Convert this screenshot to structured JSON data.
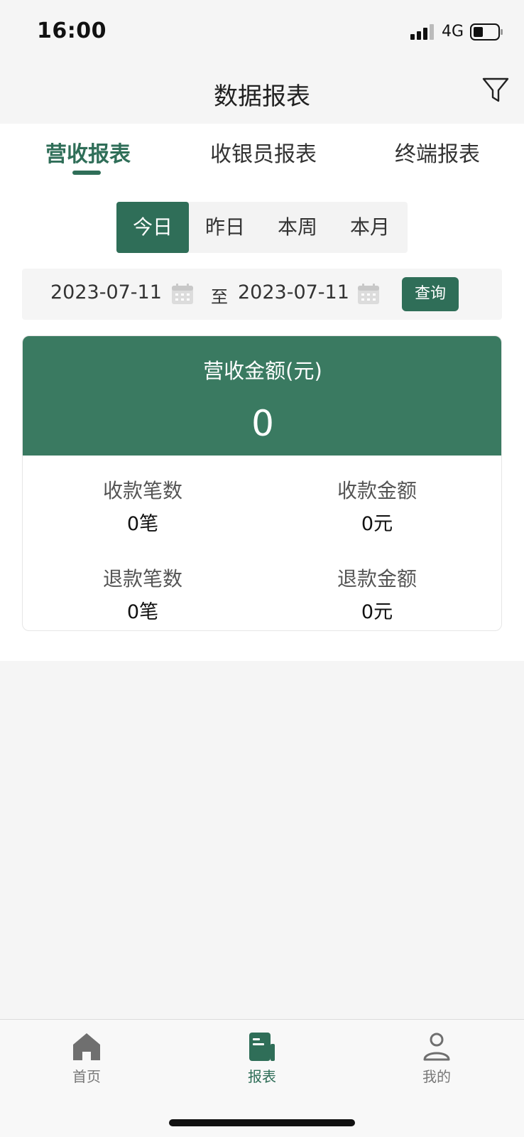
{
  "status_bar": {
    "time": "16:00",
    "network": "4G"
  },
  "header": {
    "title": "数据报表"
  },
  "tabs": [
    {
      "label": "营收报表",
      "active": true
    },
    {
      "label": "收银员报表",
      "active": false
    },
    {
      "label": "终端报表",
      "active": false
    }
  ],
  "period": {
    "options": [
      "今日",
      "昨日",
      "本周",
      "本月"
    ],
    "selected": "今日"
  },
  "date_range": {
    "start": "2023-07-11",
    "separator": "至",
    "end": "2023-07-11",
    "query_label": "查询"
  },
  "summary": {
    "revenue_label": "营收金额(元)",
    "revenue_value": "0",
    "stats": [
      {
        "label": "收款笔数",
        "value": "0笔"
      },
      {
        "label": "收款金额",
        "value": "0元"
      },
      {
        "label": "退款笔数",
        "value": "0笔"
      },
      {
        "label": "退款金额",
        "value": "0元"
      }
    ]
  },
  "tab_bar": {
    "items": [
      {
        "label": "首页",
        "icon": "home-icon",
        "active": false
      },
      {
        "label": "报表",
        "icon": "report-icon",
        "active": true
      },
      {
        "label": "我的",
        "icon": "profile-icon",
        "active": false
      }
    ]
  },
  "colors": {
    "accent": "#2f6e58",
    "card_header": "#3a7a61",
    "background": "#f5f5f5"
  }
}
